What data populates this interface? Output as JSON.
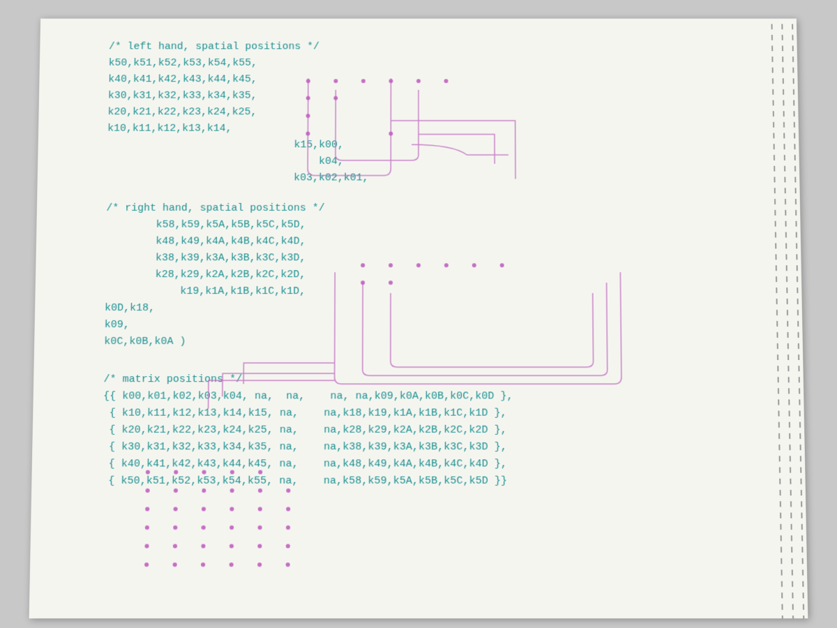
{
  "page": {
    "background": "#f5f5f0"
  },
  "code": {
    "left_hand_comment": "/* left hand, spatial positions */",
    "left_hand_lines": [
      "k50,k51,k52,k53,k54,k55,",
      "k40,k41,k42,k43,k44,k45,",
      "k30,k31,k32,k33,k34,k35,",
      "k20,k21,k22,k23,k24,k25,",
      "k10,k11,k12,k13,k14,",
      "                              k15,k00,",
      "                                  k04,",
      "                              k03,k02,k01,"
    ],
    "right_hand_comment": "/* right hand, spatial positions */",
    "right_hand_lines": [
      "        k58,k59,k5A,k5B,k5C,k5D,",
      "        k48,k49,k4A,k4B,k4C,k4D,",
      "        k38,k39,k3A,k3B,k3C,k3D,",
      "        k28,k29,k2A,k2B,k2C,k2D,",
      "            k19,k1A,k1B,k1C,k1D,",
      "k0D,k18,",
      "k09,",
      "k0C,k0B,k0A )"
    ],
    "matrix_comment": "/* matrix positions */",
    "matrix_lines": [
      "{{ k00,k01,k02,k03,k04, na,  na,   na, na,k09,k0A,k0B,k0C,k0D },",
      " { k10,k11,k12,k13,k14,k15, na,   na,k18,k19,k1A,k1B,k1C,k1D },",
      " { k20,k21,k22,k23,k24,k25, na,   na,k28,k29,k2A,k2B,k2C,k2D },",
      " { k30,k31,k32,k33,k34,k35, na,   na,k38,k39,k3A,k3B,k3C,k3D },",
      " { k40,k41,k42,k43,k44,k45, na,   na,k48,k49,k4A,k4B,k4C,k4D },",
      " { k50,k51,k52,k53,k54,k55, na,   na,k58,k59,k5A,k5B,k5C,k5D }}"
    ]
  }
}
